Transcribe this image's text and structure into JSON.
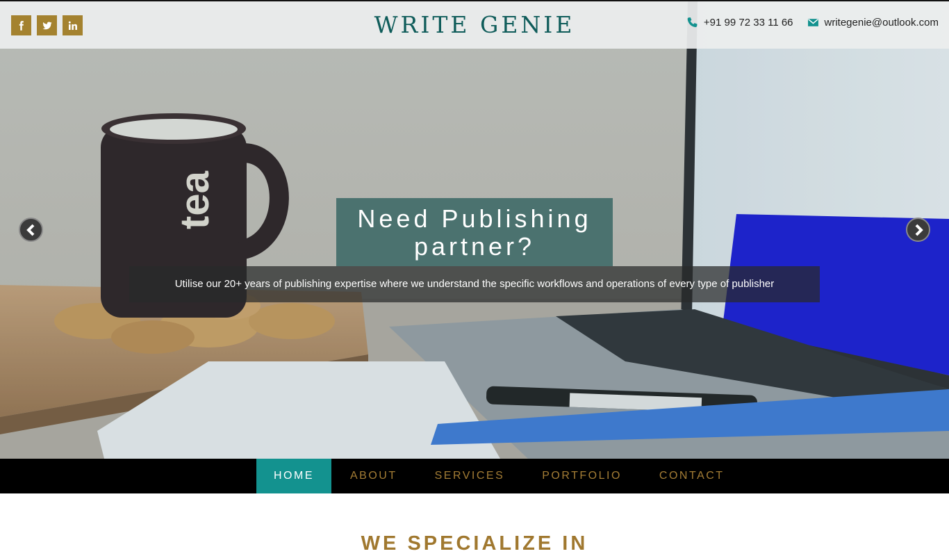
{
  "social": [
    {
      "name": "facebook-icon"
    },
    {
      "name": "twitter-icon"
    },
    {
      "name": "linkedin-icon"
    }
  ],
  "brand": {
    "title": "WRITE GENIE"
  },
  "contact": {
    "phone": "+91 99 72 33 11 66",
    "email": "writegenie@outlook.com"
  },
  "carousel": {
    "title_line1": "Need Publishing",
    "title_line2": "partner?",
    "text": "Utilise our 20+ years of publishing expertise where we understand the specific workflows and operations of every type of publisher"
  },
  "nav": [
    "HOME",
    "ABOUT",
    "SERVICES",
    "PORTFOLIO",
    "CONTACT"
  ],
  "section": {
    "title": "WE SPECIALIZE IN"
  },
  "colors": {
    "accent": "#13928f",
    "brand": "#0f5c5a",
    "gold": "#a4822f"
  }
}
